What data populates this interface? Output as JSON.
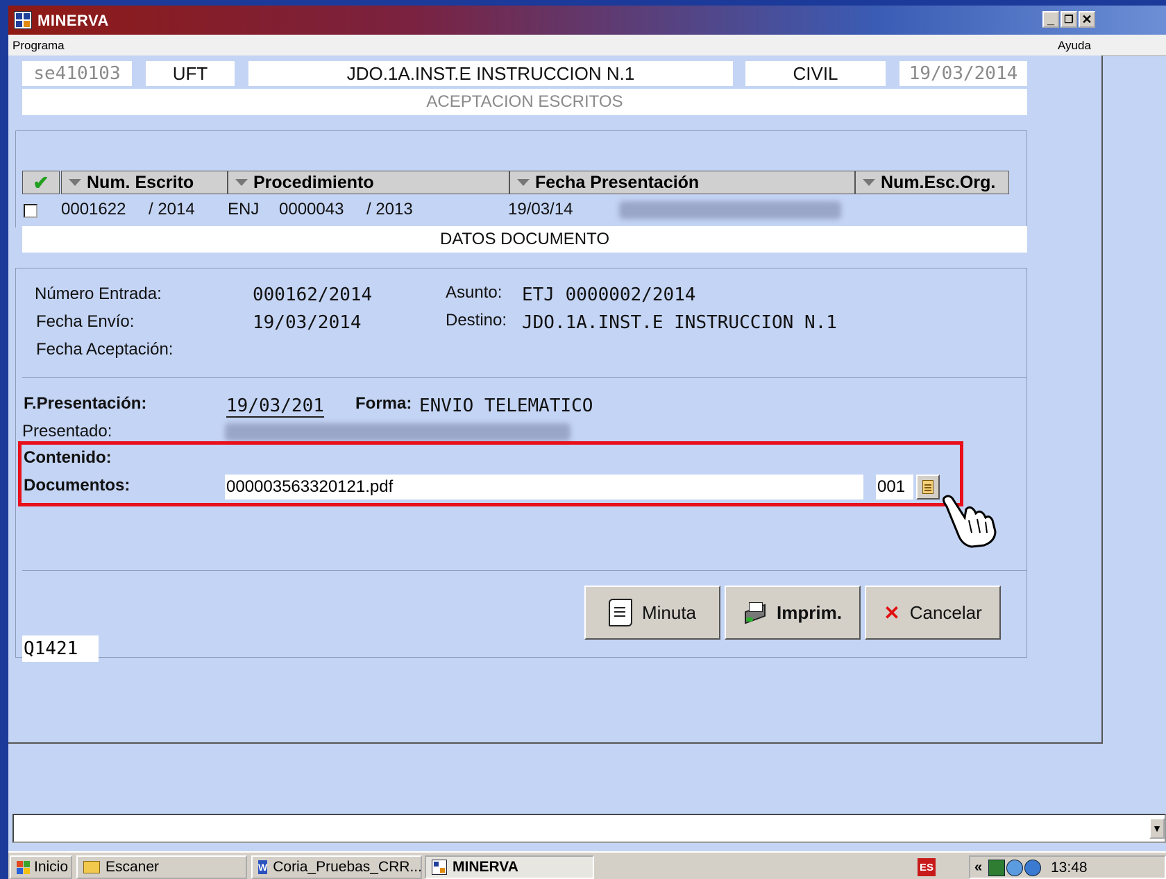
{
  "window": {
    "title": "MINERVA",
    "menu": [
      "Programa",
      "Ayuda"
    ]
  },
  "header": {
    "user_code": "se410103",
    "unit": "UFT",
    "court": "JDO.1A.INST.E INSTRUCCION N.1",
    "jurisdiction": "CIVIL",
    "date": "19/03/2014",
    "screen_title": "ACEPTACION ESCRITOS"
  },
  "grid": {
    "columns": [
      "Num. Escrito",
      "Procedimiento",
      "Fecha Presentación",
      "Num.Esc.Org."
    ],
    "row": {
      "num": "0001622",
      "num_year": "/ 2014",
      "proc_type": "ENJ",
      "proc_num": "0000043",
      "proc_year": "/ 2013",
      "fecha": "19/03/14"
    }
  },
  "datos": {
    "section_title": "DATOS DOCUMENTO",
    "numero_entrada_label": "Número Entrada:",
    "numero_entrada": "000162/2014",
    "asunto_label": "Asunto:",
    "asunto": "ETJ 0000002/2014",
    "fecha_envio_label": "Fecha Envío:",
    "fecha_envio": "19/03/2014",
    "destino_label": "Destino:",
    "destino": "JDO.1A.INST.E INSTRUCCION N.1",
    "fecha_aceptacion_label": "Fecha Aceptación:"
  },
  "presentacion": {
    "fpres_label": "F.Presentación:",
    "fpres": "19/03/201",
    "forma_label": "Forma:",
    "forma": "ENVIO TELEMATICO",
    "presentado_label": "Presentado:",
    "contenido_label": "Contenido:",
    "documentos_label": "Documentos:",
    "documento": "000003563320121.pdf",
    "doc_count": "001"
  },
  "buttons": {
    "minuta": "Minuta",
    "imprim": "Imprim.",
    "cancelar": "Cancelar"
  },
  "footer_code": "Q1421",
  "taskbar": {
    "start": "Inicio",
    "items": [
      "Escaner",
      "Coria_Pruebas_CRR...",
      "MINERVA"
    ],
    "lang": "ES",
    "clock": "13:48"
  },
  "colors": {
    "highlight": "#e8101a",
    "form_bg": "#c4d4f4"
  }
}
